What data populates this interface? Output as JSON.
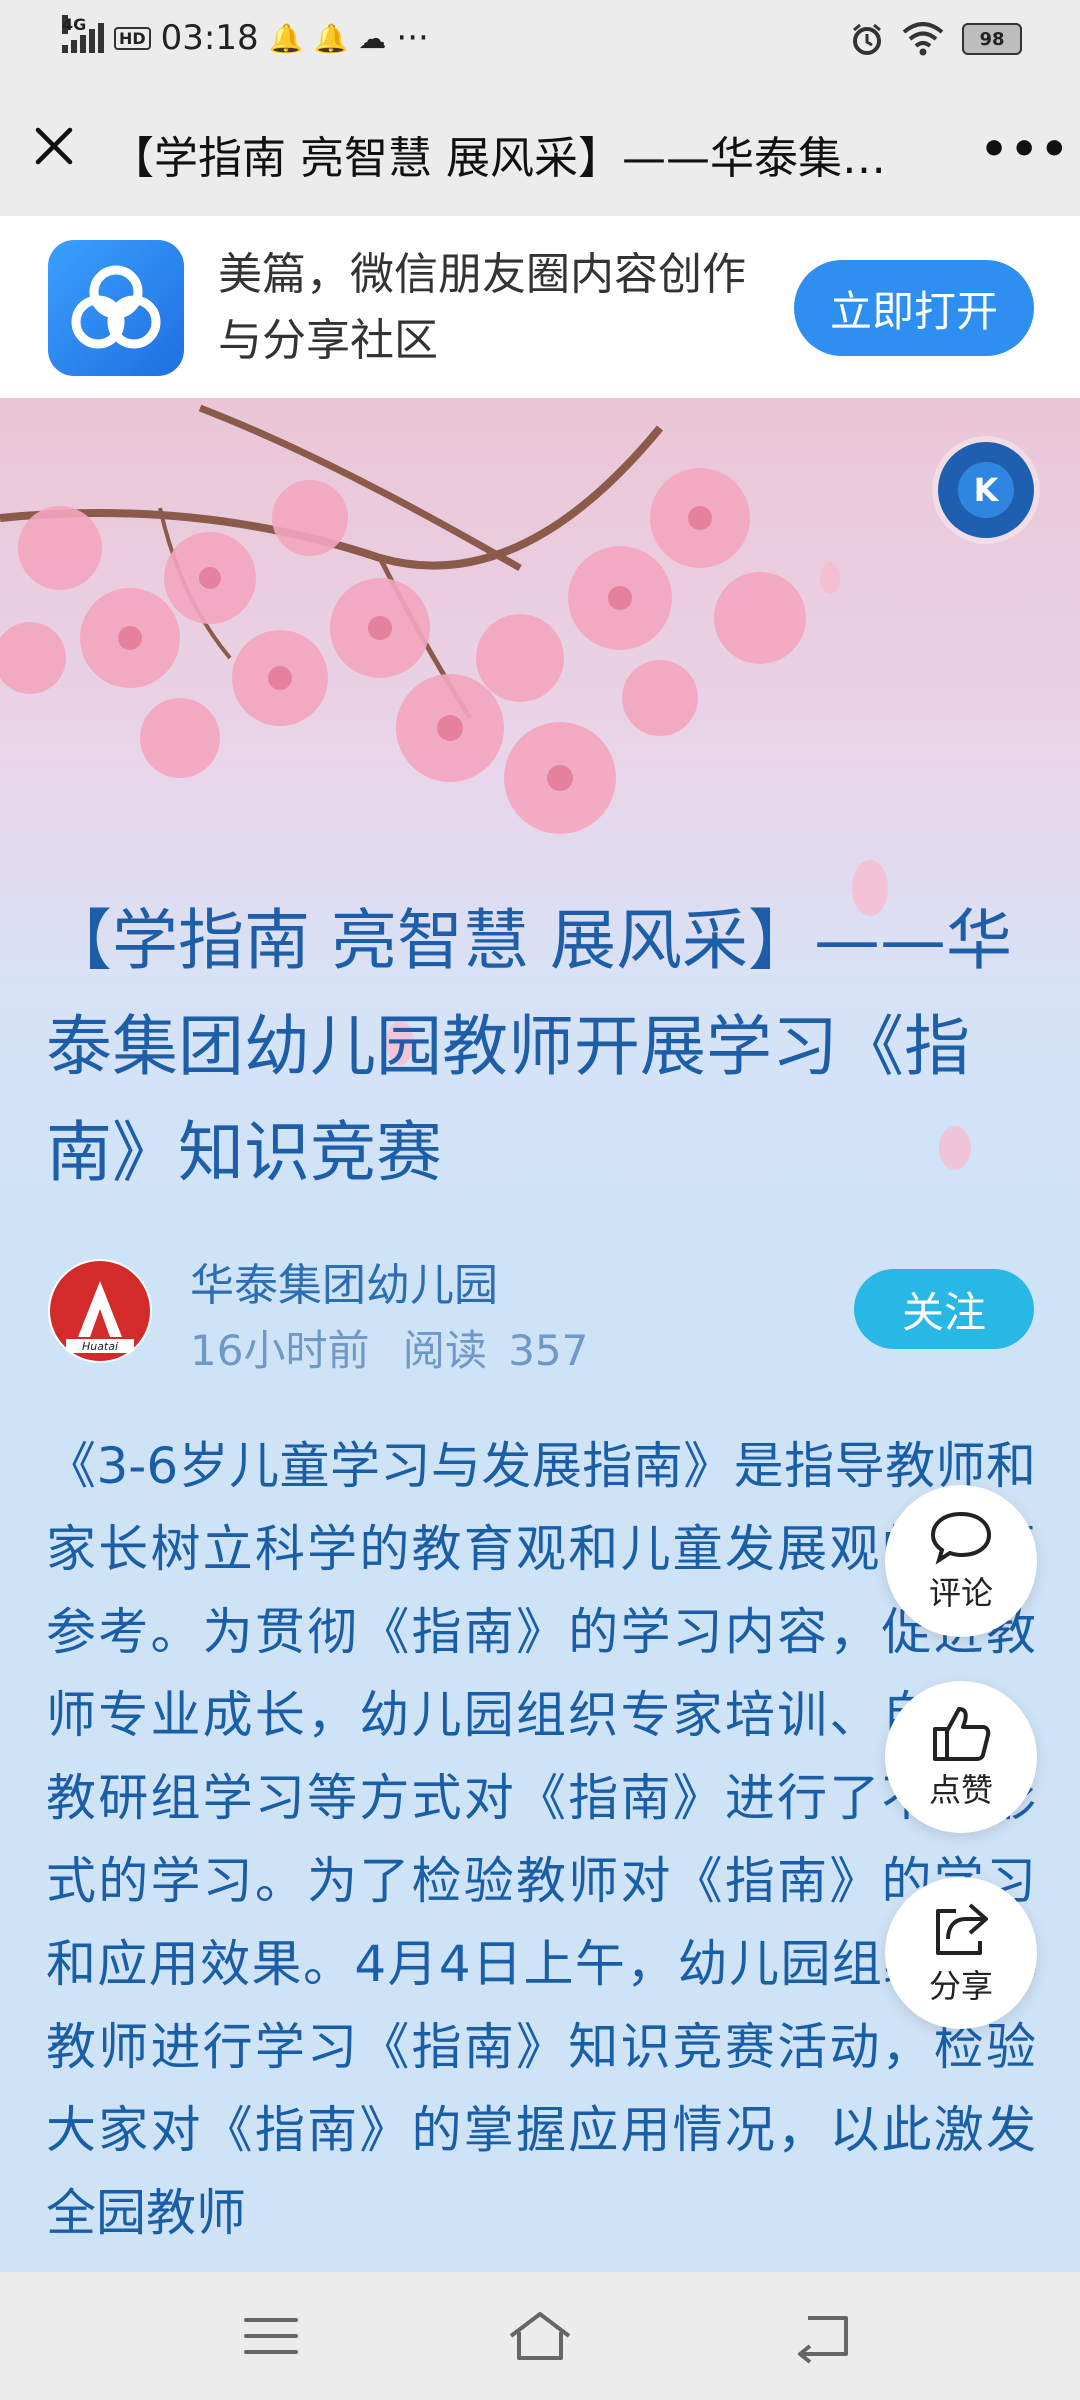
{
  "status_bar": {
    "network": "4G",
    "hd": "HD",
    "time": "03:18",
    "more": "···",
    "battery": "98"
  },
  "nav": {
    "title": "【学指南 亮智慧 展风采】——华泰集团…",
    "more_label": "•••"
  },
  "banner": {
    "text": "美篇，微信朋友圈内容创作与分享社区",
    "open_label": "立即打开"
  },
  "hero": {
    "badge": "K",
    "title": "【学指南 亮智慧 展风采】——华泰集团幼儿园教师开展学习《指南》知识竞赛"
  },
  "author": {
    "name": "华泰集团幼儿园",
    "time": "16小时前",
    "read_label": "阅读",
    "read_count": "357",
    "logo_text": "Huatai",
    "follow_label": "关注"
  },
  "article": {
    "paragraph": "《3-6岁儿童学习与发展指南》是指导教师和家长树立科学的教育观和儿童发展观的重要参考。为贯彻《指南》的学习内容，促进教师专业成长，幼儿园组织专家培训、自学、教研组学习等方式对《指南》进行了不同形式的学习。为了检验教师对《指南》的学习和应用效果。4月4日上午，幼儿园组织全体教师进行学习《指南》知识竞赛活动，检验大家对《指南》的掌握应用情况，以此激发全园教师"
  },
  "actions": {
    "comment_label": "评论",
    "like_label": "点赞",
    "share_label": "分享"
  },
  "colors": {
    "accent": "#2f8ff0",
    "follow": "#29b7e6",
    "title_blue": "#1e5ea8"
  }
}
